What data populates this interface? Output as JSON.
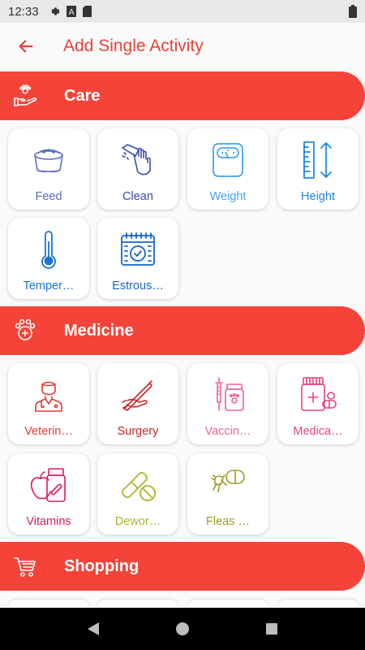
{
  "status_bar": {
    "time": "12:33"
  },
  "app_bar": {
    "title": "Add Single Activity"
  },
  "sections": {
    "care": {
      "title": "Care",
      "items": [
        {
          "label": "Feed",
          "color": "#5c6bc0"
        },
        {
          "label": "Clean",
          "color": "#3949ab"
        },
        {
          "label": "Weight",
          "color": "#42a5f5"
        },
        {
          "label": "Height",
          "color": "#1e88e5"
        },
        {
          "label": "Temper…",
          "color": "#1976d2"
        },
        {
          "label": "Estrous…",
          "color": "#1565c0"
        }
      ]
    },
    "medicine": {
      "title": "Medicine",
      "items": [
        {
          "label": "Veterin…",
          "color": "#e53935"
        },
        {
          "label": "Surgery",
          "color": "#c62828"
        },
        {
          "label": "Vaccin…",
          "color": "#f06292"
        },
        {
          "label": "Medica…",
          "color": "#ec407a"
        },
        {
          "label": "Vitamins",
          "color": "#d81b60"
        },
        {
          "label": "Dewor…",
          "color": "#afb42b"
        },
        {
          "label": "Fleas …",
          "color": "#9e9d24"
        }
      ]
    },
    "shopping": {
      "title": "Shopping"
    }
  },
  "colors": {
    "header": "#f4443a",
    "accent": "#e8403a"
  }
}
